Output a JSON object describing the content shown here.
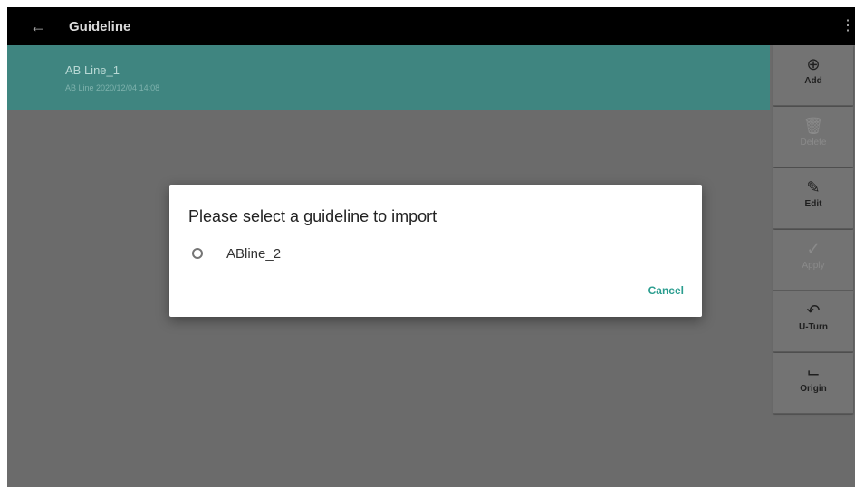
{
  "app": {
    "title": "Guideline"
  },
  "list": {
    "items": [
      {
        "name": "AB Line_1",
        "subtitle": "AB Line 2020/12/04 14:08"
      }
    ]
  },
  "side_panel": {
    "buttons": [
      {
        "label": "Add",
        "icon": "add-circle-icon",
        "enabled": true
      },
      {
        "label": "Delete",
        "icon": "trash-icon",
        "enabled": false
      },
      {
        "label": "Edit",
        "icon": "edit-icon",
        "enabled": true
      },
      {
        "label": "Apply",
        "icon": "check-icon",
        "enabled": false
      },
      {
        "label": "U-Turn",
        "icon": "u-turn-icon",
        "enabled": true
      },
      {
        "label": "Origin",
        "icon": "origin-icon",
        "enabled": true
      }
    ]
  },
  "dialog": {
    "title": "Please select a guideline to import",
    "options": [
      {
        "label": "ABline_2",
        "selected": false
      }
    ],
    "cancel_label": "Cancel"
  },
  "colors": {
    "topbar": "#000000",
    "selected_row": "#3f8580",
    "accent": "#2a9d8f",
    "overlay_background": "#6b6b6b"
  }
}
